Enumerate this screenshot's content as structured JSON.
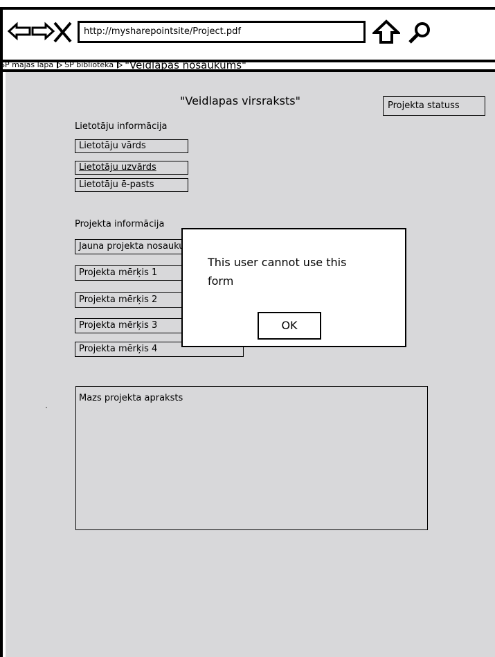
{
  "browser": {
    "url": "http://mysharepointsite/Project.pdf",
    "icons": [
      "back-arrow-icon",
      "forward-arrow-icon",
      "close-icon",
      "home-up-arrow-icon",
      "search-icon"
    ]
  },
  "breadcrumb": {
    "item1": "SP mājas lapa",
    "item2": "SP bibliotēka",
    "item3": "\"Veidlapas nosaukums\""
  },
  "form": {
    "title": "\"Veidlapas virsraksts\"",
    "status": "Projekta statuss",
    "user_section": "Lietotāju informācija",
    "user_first": "Lietotāju vārds",
    "user_last": "Lietotāju uzvārds",
    "user_email": "Lietotāju ē-pasts",
    "project_section": "Projekta informācija",
    "project_name": "Jauna projekta nosaukums",
    "goal1": "Projekta mērķis 1",
    "goal2": "Projekta mērķis 2",
    "goal3": "Projekta mērķis 3",
    "goal4": "Projekta mērķis 4",
    "description": "Mazs projekta apraksts"
  },
  "dialog": {
    "message": "This user cannot use this form",
    "ok": "OK"
  }
}
